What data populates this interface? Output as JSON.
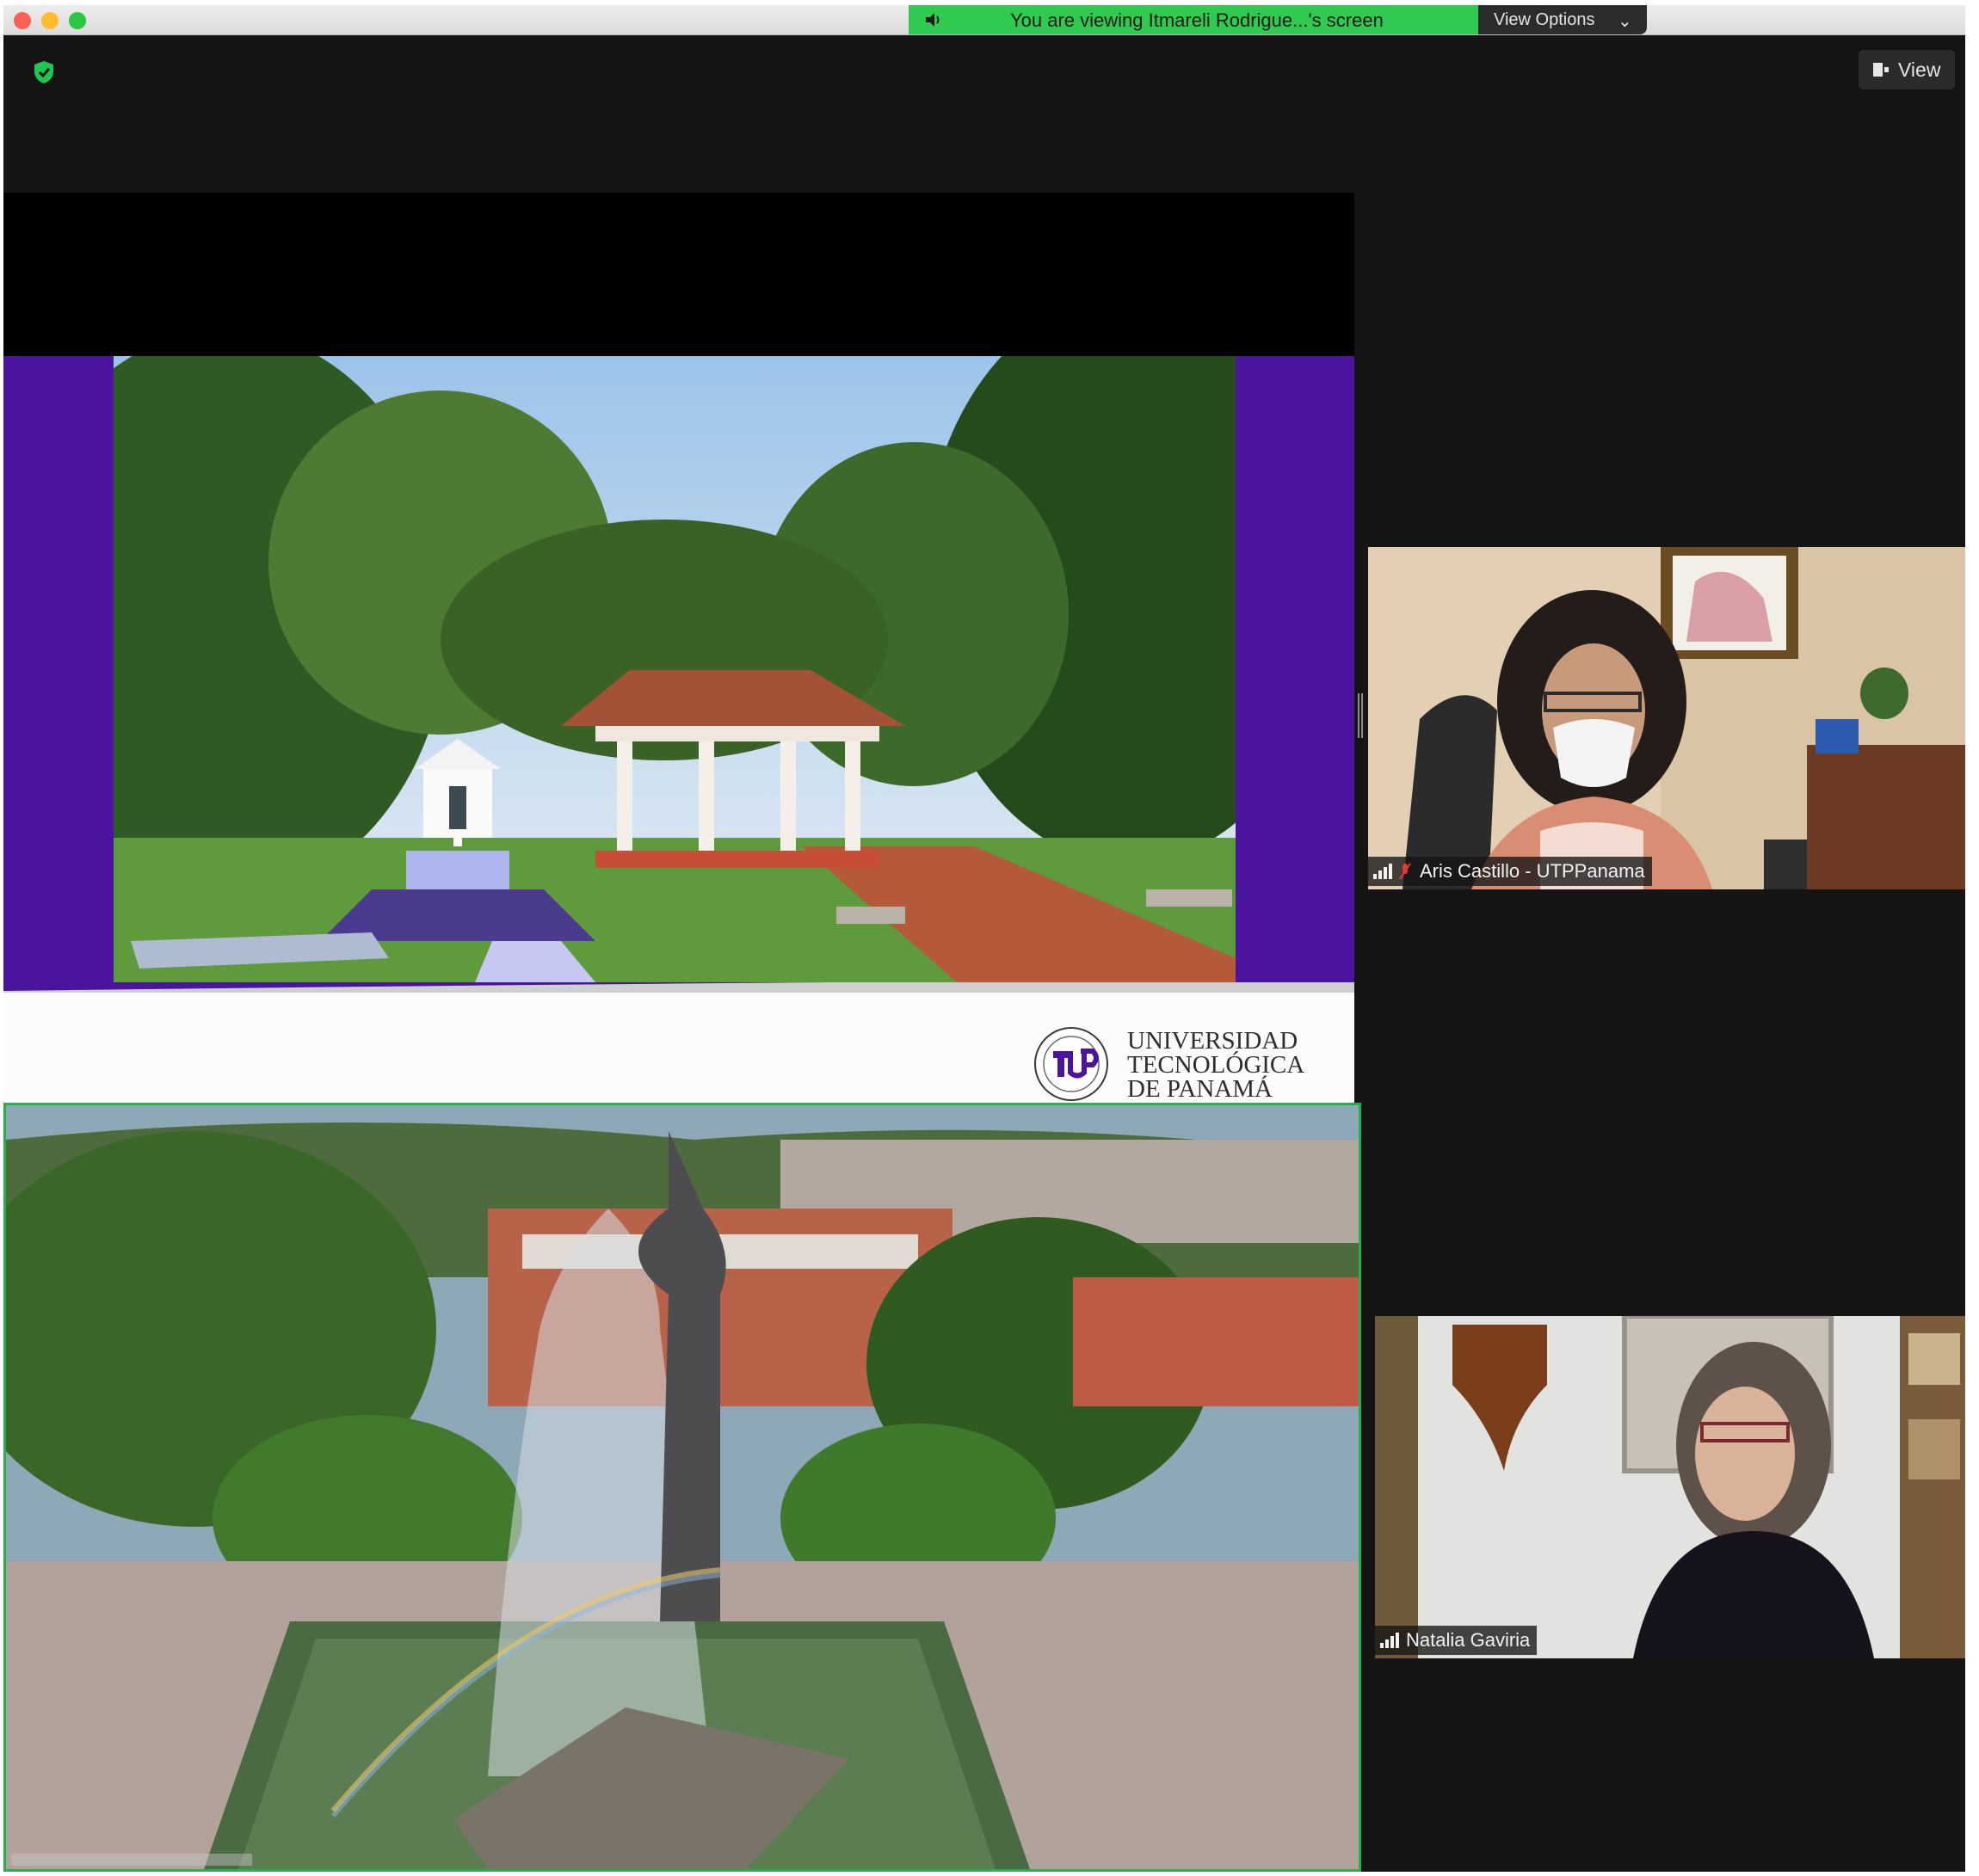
{
  "window": {
    "controls": [
      "close",
      "minimize",
      "zoom"
    ]
  },
  "share_banner": {
    "text": "You are viewing Itmareli Rodrigue...'s screen",
    "icon": "speaker-icon",
    "color": "#2fca4f"
  },
  "view_options": {
    "label": "View Options",
    "icon": "chevron-down-icon"
  },
  "toolbar": {
    "security_icon": "shield-check-icon",
    "view_label": "View"
  },
  "shared_slide": {
    "logo_lines": [
      "UNIVERSIDAD",
      "TECNOLÓGICA",
      "DE PANAMÁ"
    ],
    "accent_color": "#4a149c"
  },
  "participants": [
    {
      "name": "Aris Castillo - UTPPanama",
      "mic_muted": true
    },
    {
      "name": "Natalia Gaviria",
      "mic_muted": false
    }
  ],
  "colors": {
    "speaker_border": "#22b14c",
    "window_bg": "#141414"
  }
}
